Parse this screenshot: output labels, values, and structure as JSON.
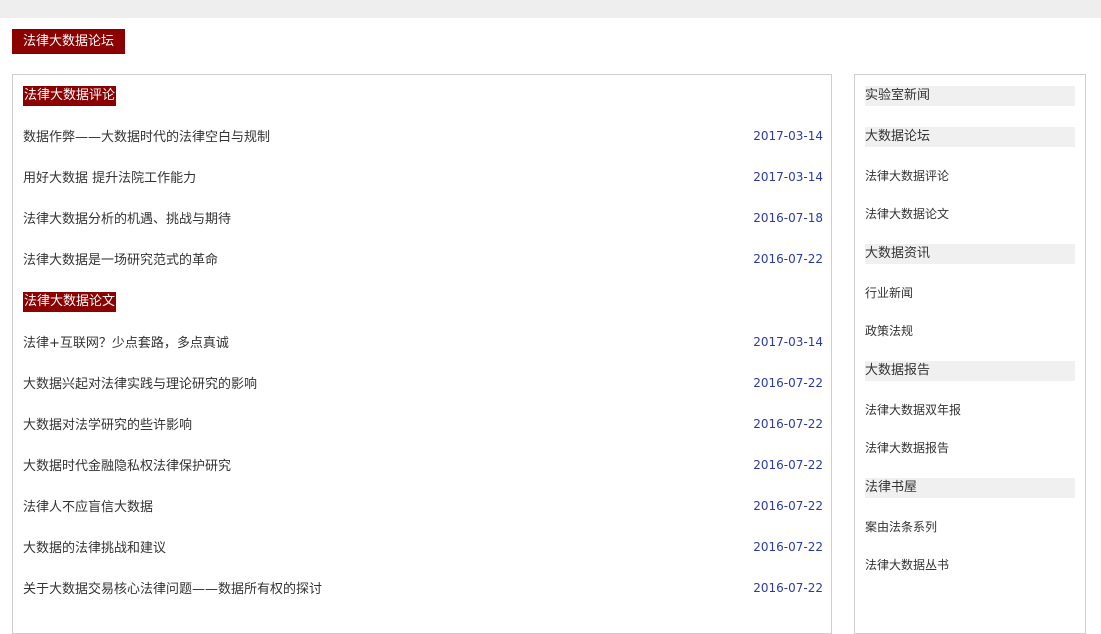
{
  "page": {
    "tag": "法律大数据论坛"
  },
  "main": {
    "sections": [
      {
        "title": "法律大数据评论",
        "items": [
          {
            "title": "数据作弊——大数据时代的法律空白与规制",
            "date": "2017-03-14"
          },
          {
            "title": "用好大数据 提升法院工作能力",
            "date": "2017-03-14"
          },
          {
            "title": "法律大数据分析的机遇、挑战与期待",
            "date": "2016-07-18"
          },
          {
            "title": "法律大数据是一场研究范式的革命",
            "date": "2016-07-22"
          }
        ]
      },
      {
        "title": "法律大数据论文",
        "items": [
          {
            "title": "法律+互联网？少点套路，多点真诚",
            "date": "2017-03-14"
          },
          {
            "title": "大数据兴起对法律实践与理论研究的影响",
            "date": "2016-07-22"
          },
          {
            "title": "大数据对法学研究的些许影响",
            "date": "2016-07-22"
          },
          {
            "title": "大数据时代金融隐私权法律保护研究",
            "date": "2016-07-22"
          },
          {
            "title": "法律人不应盲信大数据",
            "date": "2016-07-22"
          },
          {
            "title": "大数据的法律挑战和建议",
            "date": "2016-07-22"
          },
          {
            "title": "关于大数据交易核心法律问题——数据所有权的探讨",
            "date": "2016-07-22"
          }
        ]
      }
    ]
  },
  "sidebar": {
    "categories": [
      {
        "title": "实验室新闻",
        "links": []
      },
      {
        "title": "大数据论坛",
        "links": [
          "法律大数据评论",
          "法律大数据论文"
        ]
      },
      {
        "title": "大数据资讯",
        "links": [
          "行业新闻",
          "政策法规"
        ]
      },
      {
        "title": "大数据报告",
        "links": [
          "法律大数据双年报",
          "法律大数据报告"
        ]
      },
      {
        "title": "法律书屋",
        "links": [
          "案由法条系列",
          "法律大数据丛书"
        ]
      }
    ]
  },
  "colors": {
    "accent": "#8b0000",
    "date": "#2b3aa8",
    "sidebar_head_bg": "#f0f0f0",
    "topbar": "#eeeeee"
  }
}
